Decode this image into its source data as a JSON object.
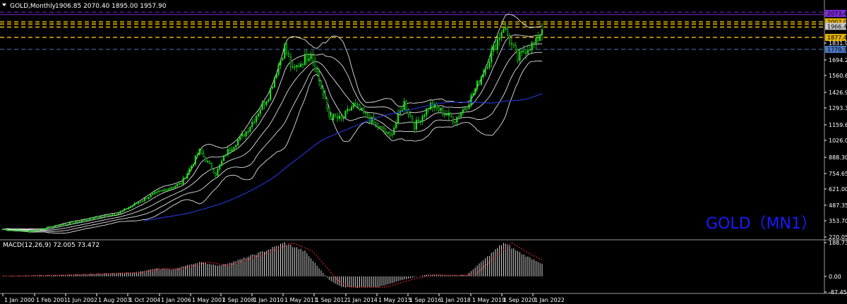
{
  "header": {
    "symbol_label": "GOLD,Monthly",
    "ohlc_label": "1906.85 2070.40 1895.00 1957.90"
  },
  "watermark": "GOLD（MN1）",
  "macd_label": "MACD(12,26,9) 72.005 73.472",
  "colors": {
    "background": "#000000",
    "bull_candle": "#22dd22",
    "bear_candle": "#22dd22",
    "bands": "#e0e0e0",
    "ma_long": "#2233cc",
    "macd_hist": "#d8d8d8",
    "macd_signal": "#dd2222",
    "level_gold": "#e0b000",
    "level_purple": "#7a2ad6",
    "level_blue": "#4a78c0"
  },
  "chart_data": [
    {
      "type": "candlestick",
      "name": "GOLD,Monthly",
      "y_ticks": [
        "220.05",
        "353.70",
        "487.35",
        "621.00",
        "754.65",
        "888.30",
        "1026.00",
        "1159.65",
        "1293.30",
        "1426.95",
        "1560.60",
        "1694.25",
        "1831.95",
        "2002.09",
        "1877.43",
        "1779.34"
      ],
      "ylim": [
        220.05,
        2095
      ],
      "x_ticks": [
        "1 Jan 2000",
        "1 Feb 2001",
        "1 Jun 2002",
        "1 Aug 2003",
        "1 Oct 2004",
        "1 Jan 2006",
        "1 May 2007",
        "1 Sep 2008",
        "1 Jan 2010",
        "1 May 2011",
        "1 Sep 2012",
        "1 Jan 2014",
        "1 May 2015",
        "1 Sep 2016",
        "1 Jan 2018",
        "1 May 2019",
        "1 Sep 2020",
        "1 Jan 2022"
      ],
      "price_path": [
        [
          "2000-01",
          285
        ],
        [
          "2001-02",
          265
        ],
        [
          "2002-06",
          320
        ],
        [
          "2003-08",
          370
        ],
        [
          "2004-10",
          420
        ],
        [
          "2006-01",
          560
        ],
        [
          "2007-05",
          670
        ],
        [
          "2008-02",
          940
        ],
        [
          "2008-10",
          750
        ],
        [
          "2009-03",
          920
        ],
        [
          "2010-01",
          1100
        ],
        [
          "2010-12",
          1400
        ],
        [
          "2011-08",
          1800
        ],
        [
          "2011-12",
          1600
        ],
        [
          "2012-09",
          1760
        ],
        [
          "2013-06",
          1230
        ],
        [
          "2013-12",
          1200
        ],
        [
          "2014-06",
          1320
        ],
        [
          "2015-12",
          1060
        ],
        [
          "2016-07",
          1340
        ],
        [
          "2016-12",
          1150
        ],
        [
          "2017-08",
          1320
        ],
        [
          "2018-08",
          1200
        ],
        [
          "2019-02",
          1320
        ],
        [
          "2019-08",
          1520
        ],
        [
          "2020-08",
          1970
        ],
        [
          "2021-03",
          1700
        ],
        [
          "2021-08",
          1800
        ],
        [
          "2021-12",
          1830
        ],
        [
          "2022-03",
          1957.9
        ]
      ],
      "levels": [
        {
          "value": 2080,
          "color": "purple",
          "style": "dashed"
        },
        {
          "value": 2060,
          "color": "purple",
          "style": "solid"
        },
        {
          "value": 2002.09,
          "color": "gold",
          "style": "dashed"
        },
        {
          "value": 1985,
          "color": "gold",
          "style": "dashed"
        },
        {
          "value": 1960,
          "color": "gold",
          "style": "dashed"
        },
        {
          "value": 1877.43,
          "color": "gold",
          "style": "dashed"
        },
        {
          "value": 1779.34,
          "color": "blue",
          "style": "dashed"
        }
      ],
      "price_badges": [
        {
          "label": "2073.45",
          "value": 2070,
          "bg": "#7a2ad6",
          "fg": "#000000"
        },
        {
          "label": "2002.09",
          "value": 2002.09,
          "bg": "#e0b000",
          "fg": "#000000"
        },
        {
          "label": "1966.44",
          "value": 1966.44,
          "bg": "#c8c8c8",
          "fg": "#000000"
        },
        {
          "label": "1877.43",
          "value": 1877.43,
          "bg": "#e0b000",
          "fg": "#000000"
        },
        {
          "label": "1779.34",
          "value": 1779.34,
          "bg": "#4a78c0",
          "fg": "#000000"
        }
      ]
    },
    {
      "type": "bar",
      "name": "MACD(12,26,9)",
      "y_ticks": [
        "188.738",
        "0.00",
        "-87.455"
      ],
      "ylim": [
        -87.455,
        188.738
      ],
      "macd_path": [
        [
          "2000-01",
          2
        ],
        [
          "2002-06",
          8
        ],
        [
          "2005-06",
          22
        ],
        [
          "2006-05",
          45
        ],
        [
          "2006-12",
          38
        ],
        [
          "2008-02",
          80
        ],
        [
          "2008-12",
          60
        ],
        [
          "2009-09",
          90
        ],
        [
          "2010-12",
          150
        ],
        [
          "2011-08",
          188
        ],
        [
          "2012-06",
          140
        ],
        [
          "2013-06",
          -20
        ],
        [
          "2013-12",
          -60
        ],
        [
          "2014-12",
          -62
        ],
        [
          "2015-06",
          -60
        ],
        [
          "2016-06",
          -20
        ],
        [
          "2017-06",
          10
        ],
        [
          "2018-06",
          5
        ],
        [
          "2019-02",
          10
        ],
        [
          "2019-09",
          80
        ],
        [
          "2020-08",
          188
        ],
        [
          "2021-06",
          120
        ],
        [
          "2022-03",
          72
        ]
      ]
    }
  ]
}
